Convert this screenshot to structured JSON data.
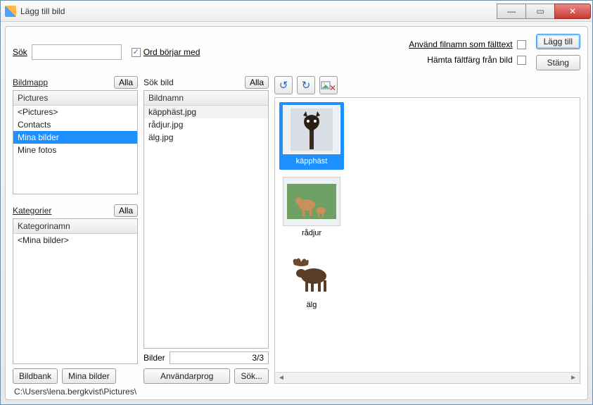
{
  "window": {
    "title": "Lägg till bild"
  },
  "search": {
    "label": "Sök",
    "value": "",
    "startsWithLabel": "Ord börjar med",
    "startsWithChecked": true
  },
  "options": {
    "useFilenameLabel": "Använd filnamn som fälttext",
    "useFilenameChecked": false,
    "pickColorLabel": "Hämta fältfärg från bild",
    "pickColorChecked": false
  },
  "actions": {
    "add": "Lägg till",
    "close": "Stäng"
  },
  "leftFolders": {
    "header": "Bildmapp",
    "allBtn": "Alla",
    "columnHeader": "Pictures",
    "rows": [
      "<Pictures>",
      "Contacts",
      "Mina bilder",
      "Mine fotos"
    ],
    "selectedIndex": 2
  },
  "categories": {
    "header": "Kategorier",
    "allBtn": "Alla",
    "columnHeader": "Kategorinamn",
    "rows": [
      "<Mina bilder>"
    ]
  },
  "midImages": {
    "header": "Sök bild",
    "allBtn": "Alla",
    "columnHeader": "Bildnamn",
    "rows": [
      "käpphäst.jpg",
      "rådjur.jpg",
      "älg.jpg"
    ],
    "selectedIndex": 0,
    "countLabel": "Bilder",
    "countText": "3/3"
  },
  "bottomButtons": {
    "bildbank": "Bildbank",
    "minaBilder": "Mina bilder",
    "anvandarprog": "Användarprog",
    "sok": "Sök..."
  },
  "toolbar": {
    "rotateLeft": "↺",
    "rotateRight": "↻",
    "delete": "✕"
  },
  "thumbs": {
    "items": [
      {
        "caption": "käpphäst",
        "selected": true
      },
      {
        "caption": "rådjur",
        "selected": false
      },
      {
        "caption": "älg",
        "selected": false
      }
    ]
  },
  "status": {
    "path": "C:\\Users\\lena.bergkvist\\Pictures\\"
  }
}
